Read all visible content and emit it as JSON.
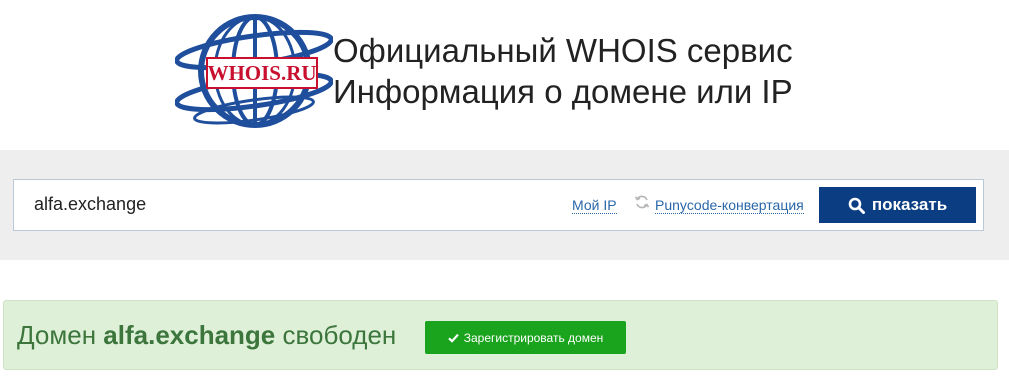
{
  "header": {
    "logo_text": "WHOIS.RU",
    "title_line1": "Официальный WHOIS сервис",
    "title_line2": "Информация о домене или IP"
  },
  "search": {
    "value": "alfa.exchange",
    "my_ip_link": "Мой IP",
    "punycode_link": "Punycode-конвертация",
    "show_button": "показать",
    "show_icon": "search-icon",
    "refresh_icon": "refresh-icon"
  },
  "result": {
    "prefix": "Домен",
    "domain": "alfa.exchange",
    "suffix": "свободен",
    "register_button": "Зарегистрировать домен",
    "register_icon": "check-icon"
  },
  "colors": {
    "brand_blue": "#0a3d82",
    "logo_red": "#c8102e",
    "success_bg": "#dff0d8",
    "success_text": "#3c763d",
    "register_green": "#1aa31d",
    "link_blue": "#2a67a8"
  }
}
